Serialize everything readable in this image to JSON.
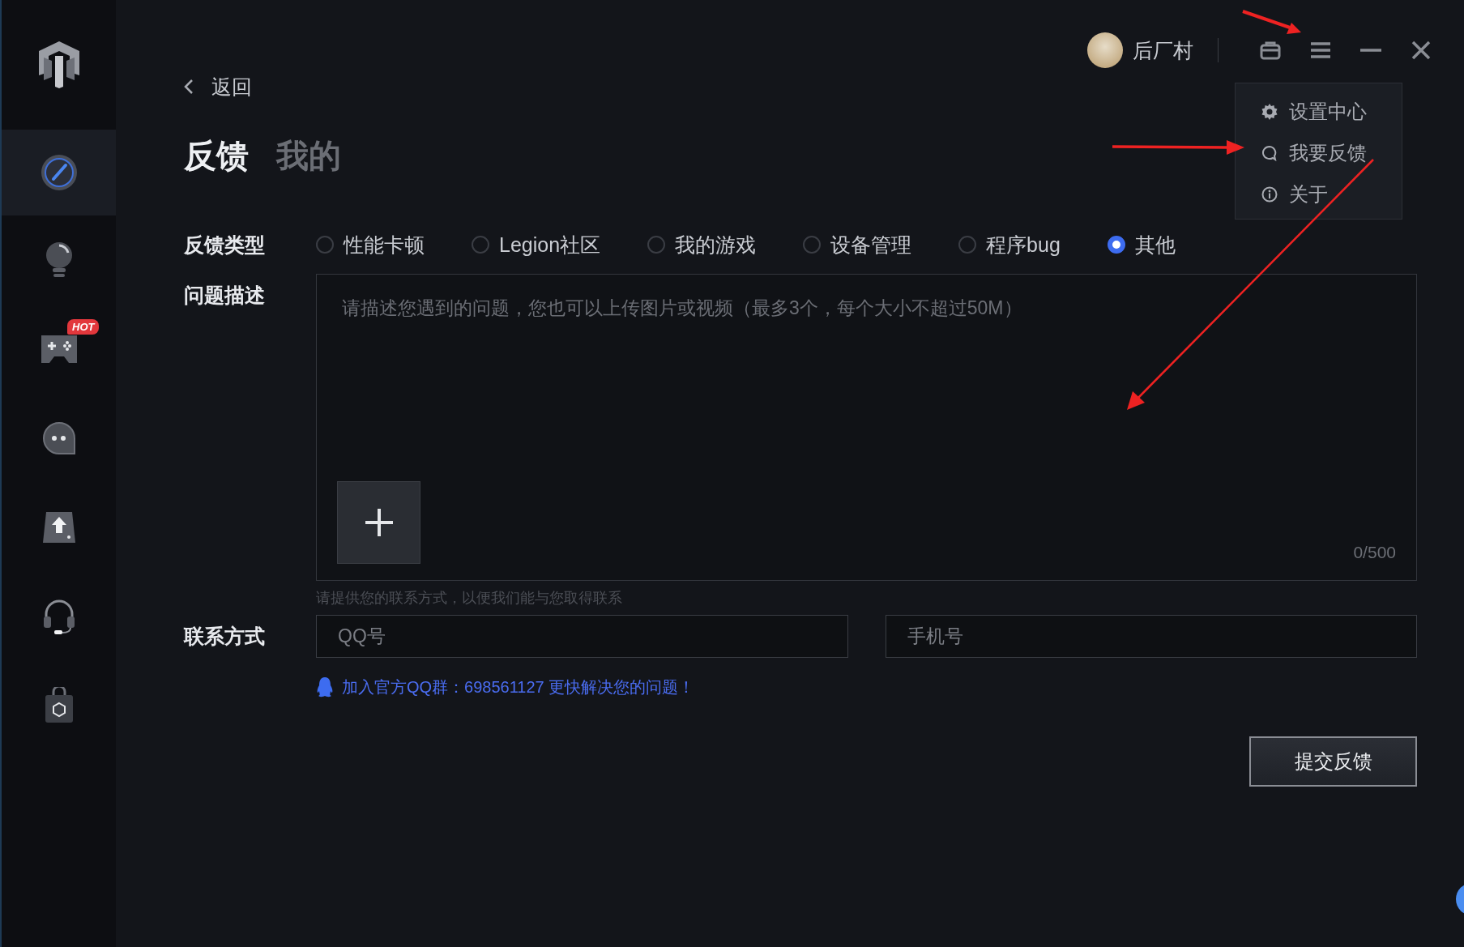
{
  "sidebar": {
    "items": [
      {
        "kind": "gauge",
        "selected": true
      },
      {
        "kind": "bulb",
        "selected": false
      },
      {
        "kind": "gamepad",
        "selected": false,
        "badge": "HOT"
      },
      {
        "kind": "chat",
        "selected": false
      },
      {
        "kind": "upload",
        "selected": false
      },
      {
        "kind": "headset",
        "selected": false
      },
      {
        "kind": "bag",
        "selected": false
      }
    ]
  },
  "header": {
    "user": {
      "name": "后厂村"
    }
  },
  "menu": {
    "items": [
      {
        "kind": "settings",
        "label": "设置中心"
      },
      {
        "kind": "feedback",
        "label": "我要反馈"
      },
      {
        "kind": "about",
        "label": "关于"
      }
    ]
  },
  "back": {
    "label": "返回"
  },
  "tabs": [
    {
      "label": "反馈",
      "selected": true
    },
    {
      "label": "我的",
      "selected": false
    }
  ],
  "form": {
    "type": {
      "label": "反馈类型",
      "options": [
        {
          "label": "性能卡顿",
          "selected": false
        },
        {
          "label": "Legion社区",
          "selected": false
        },
        {
          "label": "我的游戏",
          "selected": false
        },
        {
          "label": "设备管理",
          "selected": false
        },
        {
          "label": "程序bug",
          "selected": false
        },
        {
          "label": "其他",
          "selected": true
        }
      ]
    },
    "description": {
      "label": "问题描述",
      "placeholder": "请描述您遇到的问题，您也可以上传图片或视频（最多3个，每个大小不超过50M）",
      "counter": "0/500"
    },
    "contact": {
      "hint": "请提供您的联系方式，以便我们能与您取得联系",
      "label": "联系方式",
      "qq_placeholder": "QQ号",
      "phone_placeholder": "手机号"
    },
    "qq_group": "加入官方QQ群：698561127 更快解决您的问题！",
    "submit": "提交反馈"
  }
}
